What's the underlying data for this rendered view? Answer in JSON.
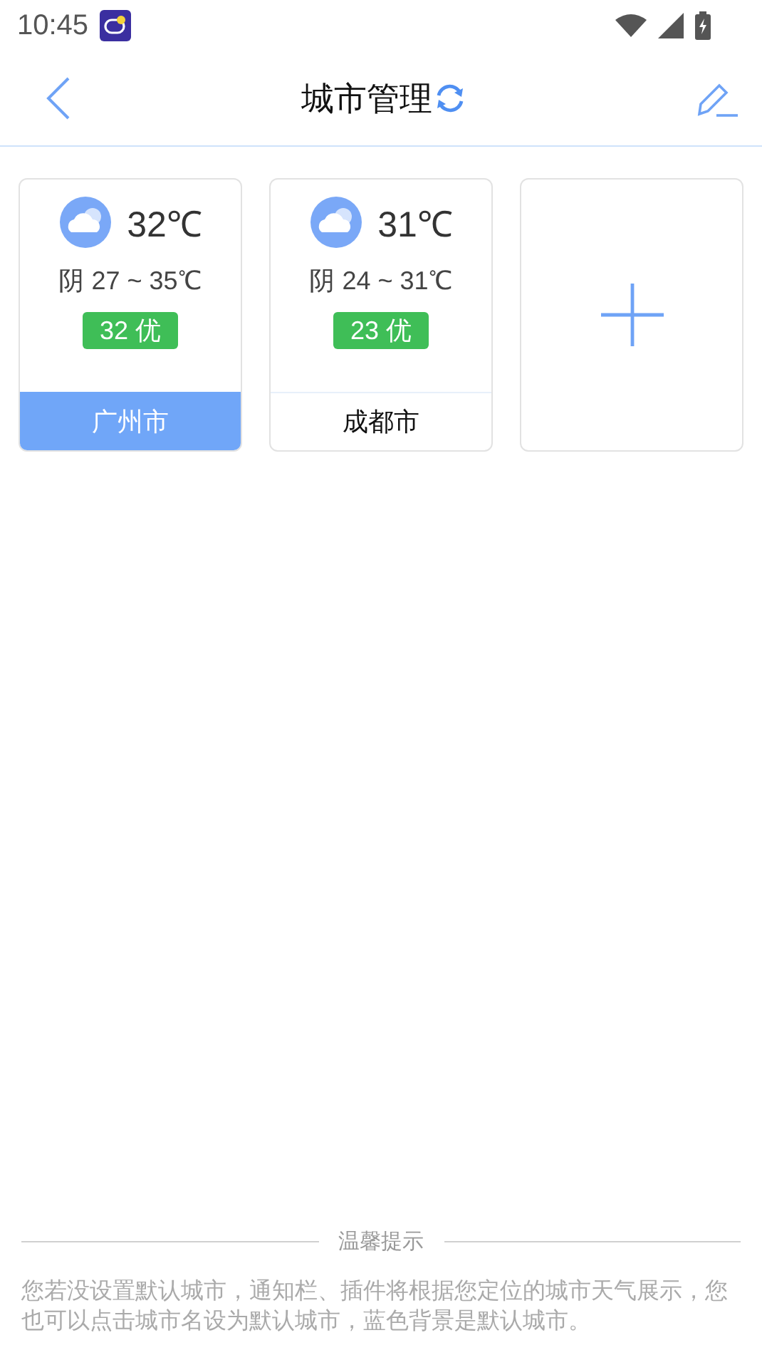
{
  "status_bar": {
    "time": "10:45"
  },
  "header": {
    "title": "城市管理"
  },
  "cities": [
    {
      "temp": "32℃",
      "range": "阴 27 ~ 35℃",
      "aqi": "32 优",
      "color": "#3fbe57",
      "name": "广州市",
      "selected": true
    },
    {
      "temp": "31℃",
      "range": "阴 24 ~ 31℃",
      "aqi": "23 优",
      "color": "#3fbe57",
      "name": "成都市",
      "selected": false
    }
  ],
  "tip": {
    "title": "温馨提示",
    "text": "您若没设置默认城市，通知栏、插件将根据您定位的城市天气展示，您也可以点击城市名设为默认城市，蓝色背景是默认城市。"
  }
}
